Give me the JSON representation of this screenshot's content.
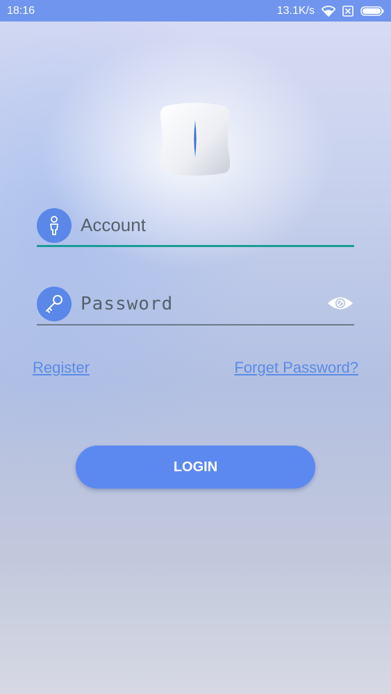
{
  "status_bar": {
    "time": "18:16",
    "network_speed": "13.1K/s",
    "icons": [
      "wifi-icon",
      "sim-none-icon",
      "battery-icon"
    ]
  },
  "logo": {
    "icon": "device-logo-icon"
  },
  "account": {
    "icon": "person-icon",
    "placeholder": "Account",
    "value": ""
  },
  "password": {
    "icon": "key-icon",
    "placeholder": "Password",
    "value": "",
    "visibility_icon": "eye-icon"
  },
  "links": {
    "register": "Register",
    "forget_password": "Forget Password?"
  },
  "login_button": {
    "label": "LOGIN"
  },
  "colors": {
    "status_bar": "#6f95ee",
    "accent": "#5c89f0",
    "account_underline": "#1a9c95",
    "link": "#5a8be6"
  }
}
